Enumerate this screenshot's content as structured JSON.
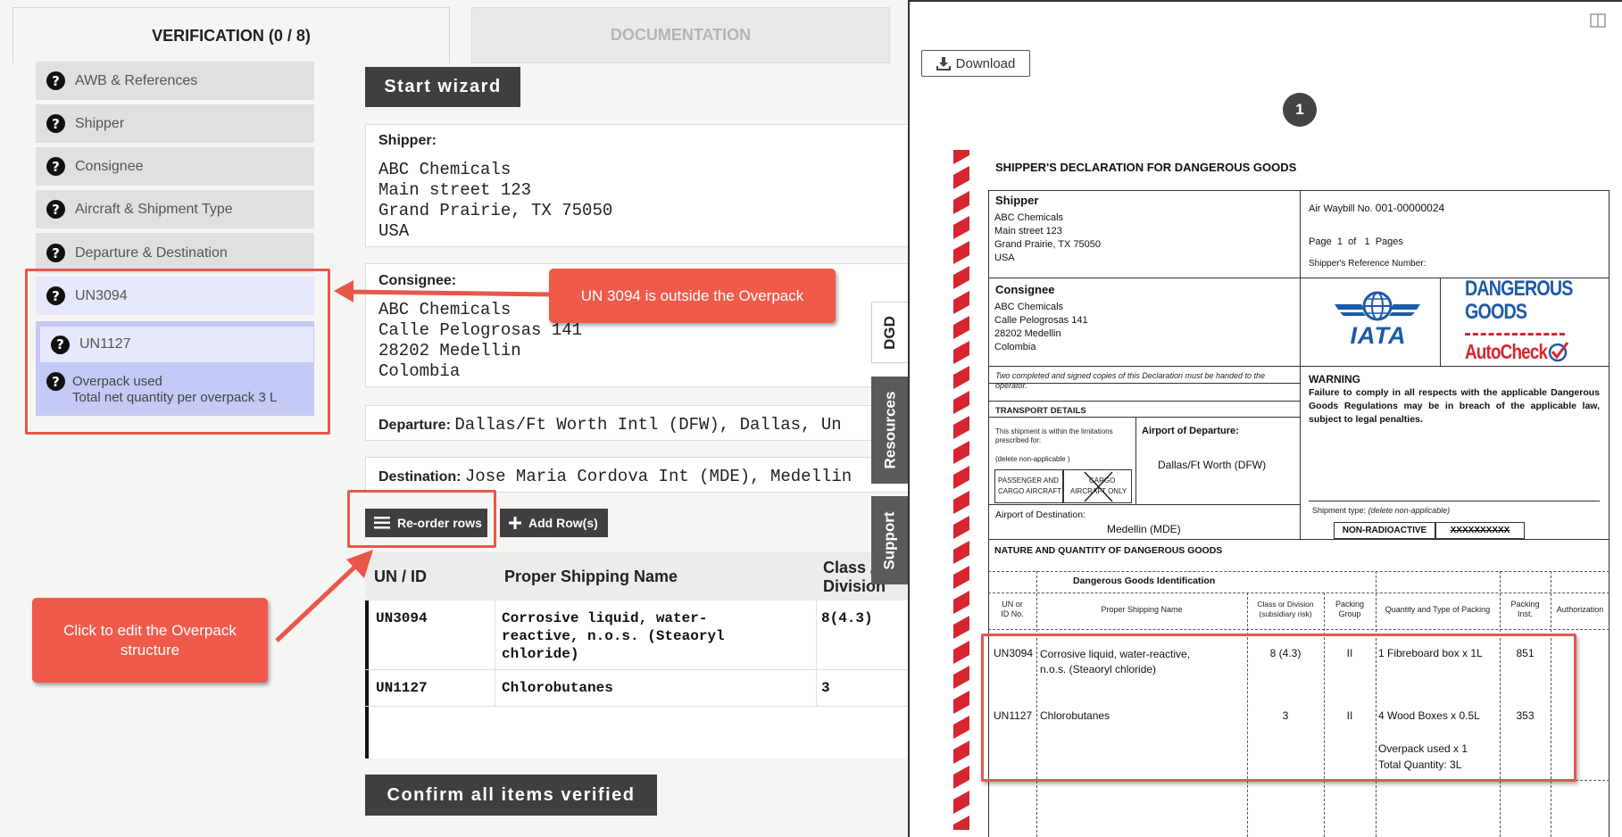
{
  "tabs": {
    "verification": "VERIFICATION (0 / 8)",
    "documentation": "DOCUMENTATION"
  },
  "nav": {
    "items": [
      "AWB & References",
      "Shipper",
      "Consignee",
      "Aircraft & Shipment Type",
      "Departure & Destination"
    ],
    "un3094": "UN3094",
    "un1127": "UN1127",
    "overpack_line1": "Overpack used",
    "overpack_line2": "Total net quantity per overpack 3 L",
    "help_glyph": "?"
  },
  "wizard_label": "Start wizard",
  "shipper": {
    "label": "Shipper:",
    "lines": [
      "ABC Chemicals",
      "Main street 123",
      "Grand Prairie, TX 75050",
      "USA"
    ]
  },
  "consignee": {
    "label": "Consignee:",
    "lines": [
      "ABC Chemicals",
      "Calle Pelogrosas 141",
      "28202 Medellin",
      "Colombia"
    ]
  },
  "departure": {
    "label": "Departure:",
    "value": "Dallas/Ft Worth Intl (DFW), Dallas, Un"
  },
  "destination": {
    "label": "Destination:",
    "value": "Jose Maria Cordova Int (MDE), Medellin"
  },
  "toolbar": {
    "reorder": "Re-order rows",
    "add_rows": "Add Row(s)"
  },
  "table": {
    "headers": [
      "UN / ID",
      "Proper Shipping Name",
      "Class / Division"
    ],
    "header_class_line1": "Class /",
    "header_class_line2": "Division",
    "rows": [
      {
        "id": "UN3094",
        "name": [
          "Corrosive liquid, water-",
          "reactive, n.o.s. (Steaoryl",
          "chloride)"
        ],
        "cls": "8(4.3)"
      },
      {
        "id": "UN1127",
        "name": [
          "Chlorobutanes"
        ],
        "cls": "3"
      }
    ]
  },
  "confirm_label": "Confirm all items verified",
  "side_tabs": [
    "DGD",
    "Resources",
    "Support"
  ],
  "callouts": {
    "outside": "UN 3094 is outside the Overpack",
    "edit_line1": "Click to edit the Overpack",
    "edit_line2": "structure"
  },
  "viewer": {
    "download": "Download",
    "page_number": "1"
  },
  "doc": {
    "title": "SHIPPER'S DECLARATION FOR DANGEROUS GOODS",
    "shipper_label": "Shipper",
    "shipper_lines": [
      "ABC Chemicals",
      "Main street 123",
      "Grand Prairie, TX 75050",
      "USA"
    ],
    "awb_label": "Air Waybill No.",
    "awb_value": "001-00000024",
    "page_label": "Page",
    "page_num": "1",
    "of_label": "of",
    "pages_num": "1",
    "pages_label": "Pages",
    "ref_label": "Shipper's Reference Number:",
    "consignee_label": "Consignee",
    "consignee_lines": [
      "ABC Chemicals",
      "Calle Pelogrosas 141",
      "28202 Medellin",
      "Colombia"
    ],
    "iata": "IATA",
    "dg_line1": "DANGEROUS",
    "dg_line2": "GOODS",
    "autocheck": "AutoCheck",
    "copies_note": "Two completed and signed copies of this Declaration must be handed to the operator.",
    "warning_title": "WARNING",
    "warning_text": "Failure to comply in all respects with the applicable Dangerous Goods Regulations may be in breach of the applicable law, subject to legal penalties.",
    "transport_title": "TRANSPORT DETAILS",
    "limits_note_1": "This shipment is within the limitations",
    "limits_note_2": "prescribed for:",
    "limits_note_3": "(delete non-applicable )",
    "pax_1": "PASSENGER AND",
    "pax_2": "CARGO AIRCRAFT",
    "cargo_1": "CARGO",
    "cargo_2": "AIRCRAFT ONLY",
    "aod_label": "Airport of Departure:",
    "aod_value": "Dallas/Ft Worth (DFW)",
    "dest_label": "Airport of Destination:",
    "dest_value": "Medellin (MDE)",
    "shipment_type": "Shipment type:",
    "shipment_type_note": "(delete non-applicable)",
    "non_radio": "NON-RADIOACTIVE",
    "radio_crossed": "XXXXXXXXXX",
    "nature_title": "NATURE AND QUANTITY OF DANGEROUS GOODS",
    "dgi_title": "Dangerous Goods Identification",
    "col_un_1": "UN or",
    "col_un_2": "ID No.",
    "col_psn": "Proper Shipping Name",
    "col_class_1": "Class or Division",
    "col_class_2": "(subsidiary risk)",
    "col_pg_1": "Packing",
    "col_pg_2": "Group",
    "col_qty": "Quantity and Type of Packing",
    "col_pi_1": "Packing",
    "col_pi_2": "Inst.",
    "col_auth": "Authorization",
    "r1_un": "UN3094",
    "r1_psn_1": "Corrosive liquid, water-reactive,",
    "r1_psn_2": "n.o.s. (Steaoryl chloride)",
    "r1_class": "8 (4.3)",
    "r1_pg": "II",
    "r1_qty": "1 Fibreboard box x 1L",
    "r1_pi": "851",
    "r2_un": "UN1127",
    "r2_psn": "Chlorobutanes",
    "r2_class": "3",
    "r2_pg": "II",
    "r2_qty": "4 Wood Boxes x 0.5L",
    "r2_pi": "353",
    "overpack_1": "Overpack used x 1",
    "overpack_2": "Total Quantity: 3L"
  },
  "colors": {
    "accent_red": "#f05a4a",
    "dark_button": "#3f3f3f",
    "nav_gray": "#e0e0e0",
    "nav_selected": "#c5c9f5",
    "nav_light": "#e6e8fb"
  },
  "icons": [
    "help-icon",
    "hamburger-icon",
    "plus-icon",
    "download-icon",
    "split-view-icon",
    "iata-globe-icon",
    "checkmark-icon"
  ]
}
